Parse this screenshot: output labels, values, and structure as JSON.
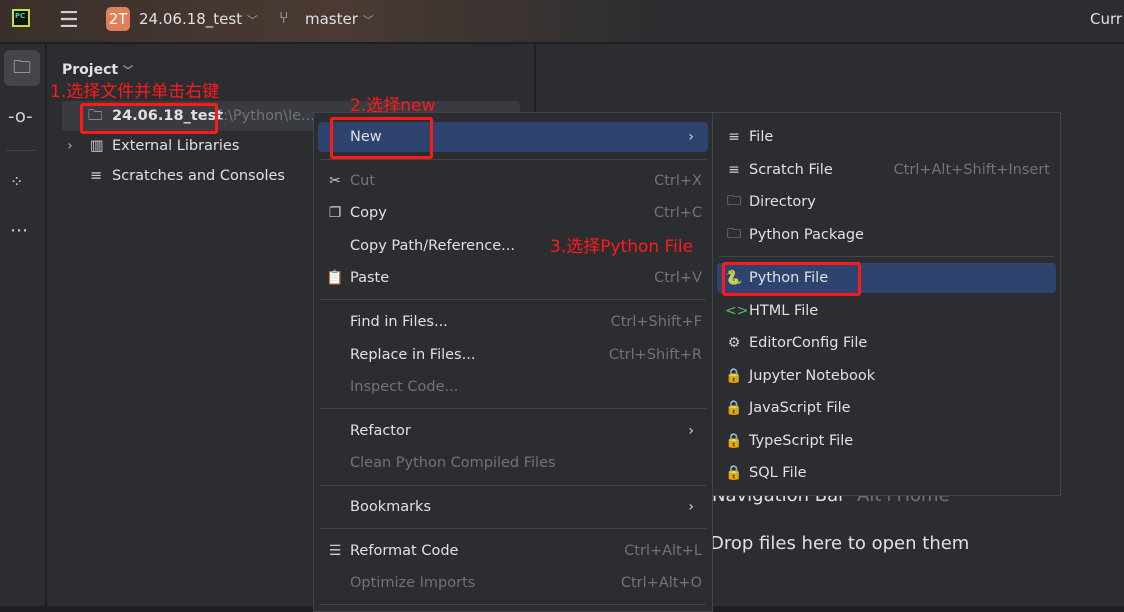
{
  "titlebar": {
    "logo": "PC",
    "project_badge": "2T",
    "project_name": "24.06.18_test",
    "branch": "master",
    "right_text": "Curr"
  },
  "project_panel": {
    "title": "Project",
    "tree": [
      {
        "label": "24.06.18_test",
        "path": "E:\\Python\\le...",
        "icon": "folder-icon"
      },
      {
        "label": "External Libraries",
        "icon": "library-icon"
      },
      {
        "label": "Scratches and Consoles",
        "icon": "scratch-icon"
      }
    ]
  },
  "context_menu": {
    "items": [
      {
        "label": "New",
        "submenu": true
      },
      {
        "label": "Cut",
        "shortcut": "Ctrl+X",
        "disabled": true,
        "icon": "scissors-icon"
      },
      {
        "label": "Copy",
        "shortcut": "Ctrl+C",
        "icon": "copy-icon"
      },
      {
        "label": "Copy Path/Reference..."
      },
      {
        "label": "Paste",
        "shortcut": "Ctrl+V",
        "icon": "paste-icon"
      },
      {
        "label": "Find in Files...",
        "shortcut": "Ctrl+Shift+F"
      },
      {
        "label": "Replace in Files...",
        "shortcut": "Ctrl+Shift+R"
      },
      {
        "label": "Inspect Code...",
        "disabled": true
      },
      {
        "label": "Refactor",
        "submenu": true
      },
      {
        "label": "Clean Python Compiled Files",
        "disabled": true
      },
      {
        "label": "Bookmarks",
        "submenu": true
      },
      {
        "label": "Reformat Code",
        "shortcut": "Ctrl+Alt+L",
        "icon": "reformat-icon"
      },
      {
        "label": "Optimize Imports",
        "shortcut": "Ctrl+Alt+O",
        "disabled": true
      }
    ]
  },
  "new_submenu": {
    "items": [
      {
        "label": "File",
        "icon": "file-icon"
      },
      {
        "label": "Scratch File",
        "shortcut": "Ctrl+Alt+Shift+Insert",
        "icon": "scratch-icon"
      },
      {
        "label": "Directory",
        "icon": "folder-icon"
      },
      {
        "label": "Python Package",
        "icon": "package-icon"
      },
      {
        "label": "Python File",
        "icon": "python-icon"
      },
      {
        "label": "HTML File",
        "icon": "html-icon"
      },
      {
        "label": "EditorConfig File",
        "icon": "gear-icon"
      },
      {
        "label": "Jupyter Notebook",
        "icon": "lock-icon"
      },
      {
        "label": "JavaScript File",
        "icon": "lock-icon"
      },
      {
        "label": "TypeScript File",
        "icon": "lock-icon"
      },
      {
        "label": "SQL File",
        "icon": "lock-icon"
      }
    ]
  },
  "editor": {
    "nav_bar": "Navigation Bar",
    "nav_bar_shortcut": "Alt+Home",
    "drop_hint": "Drop files here to open them"
  },
  "annotations": {
    "step1": "1.选择文件并单击右键",
    "step2": "2.选择new",
    "step3": "3.选择Python File"
  },
  "colors": {
    "selection": "#2e436e",
    "annotation": "#ff1a1a",
    "background": "#2b2d30"
  }
}
